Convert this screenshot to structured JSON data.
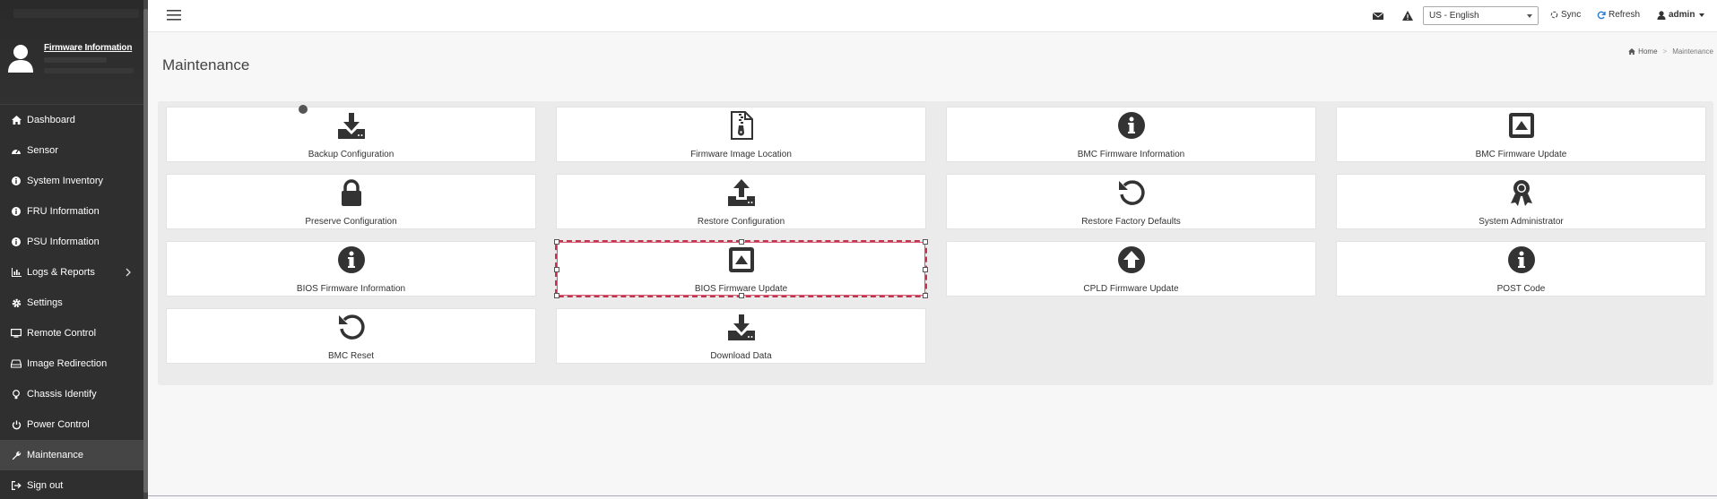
{
  "sidebar": {
    "firmware_link": "Firmware Information",
    "items": [
      {
        "label": "Dashboard",
        "icon": "home-icon"
      },
      {
        "label": "Sensor",
        "icon": "gauge-icon"
      },
      {
        "label": "System Inventory",
        "icon": "info-icon"
      },
      {
        "label": "FRU Information",
        "icon": "info-icon"
      },
      {
        "label": "PSU Information",
        "icon": "info-icon"
      },
      {
        "label": "Logs & Reports",
        "icon": "bar-chart-icon"
      },
      {
        "label": "Settings",
        "icon": "gear-icon"
      },
      {
        "label": "Remote Control",
        "icon": "monitor-icon"
      },
      {
        "label": "Image Redirection",
        "icon": "drive-icon"
      },
      {
        "label": "Chassis Identify",
        "icon": "lightbulb-icon"
      },
      {
        "label": "Power Control",
        "icon": "power-icon"
      },
      {
        "label": "Maintenance",
        "icon": "wrench-icon"
      },
      {
        "label": "Sign out",
        "icon": "sign-out-icon"
      }
    ]
  },
  "topbar": {
    "language": "US - English",
    "sync_label": "Sync",
    "refresh_label": "Refresh",
    "user_label": "admin"
  },
  "page": {
    "title": "Maintenance",
    "breadcrumb_home": "Home",
    "breadcrumb_current": "Maintenance"
  },
  "tiles": [
    {
      "label": "Backup Configuration",
      "icon": "download-icon"
    },
    {
      "label": "Firmware Image Location",
      "icon": "zip-file-icon"
    },
    {
      "label": "BMC Firmware Information",
      "icon": "info-icon"
    },
    {
      "label": "BMC Firmware Update",
      "icon": "eject-box-icon"
    },
    {
      "label": "Preserve Configuration",
      "icon": "lock-icon"
    },
    {
      "label": "Restore Configuration",
      "icon": "upload-icon"
    },
    {
      "label": "Restore Factory Defaults",
      "icon": "undo-icon"
    },
    {
      "label": "System Administrator",
      "icon": "award-icon"
    },
    {
      "label": "BIOS Firmware Information",
      "icon": "info-icon"
    },
    {
      "label": "BIOS Firmware Update",
      "icon": "eject-box-icon"
    },
    {
      "label": "CPLD Firmware Update",
      "icon": "arrow-up-circle-icon"
    },
    {
      "label": "POST Code",
      "icon": "info-icon"
    },
    {
      "label": "BMC Reset",
      "icon": "undo-icon"
    },
    {
      "label": "Download Data",
      "icon": "download-icon"
    }
  ],
  "colors": {
    "sidebar_bg": "#2f2f2f",
    "sidebar_active": "#454545",
    "selection_outline": "#c0344f",
    "refresh_blue": "#2a7bd4"
  }
}
